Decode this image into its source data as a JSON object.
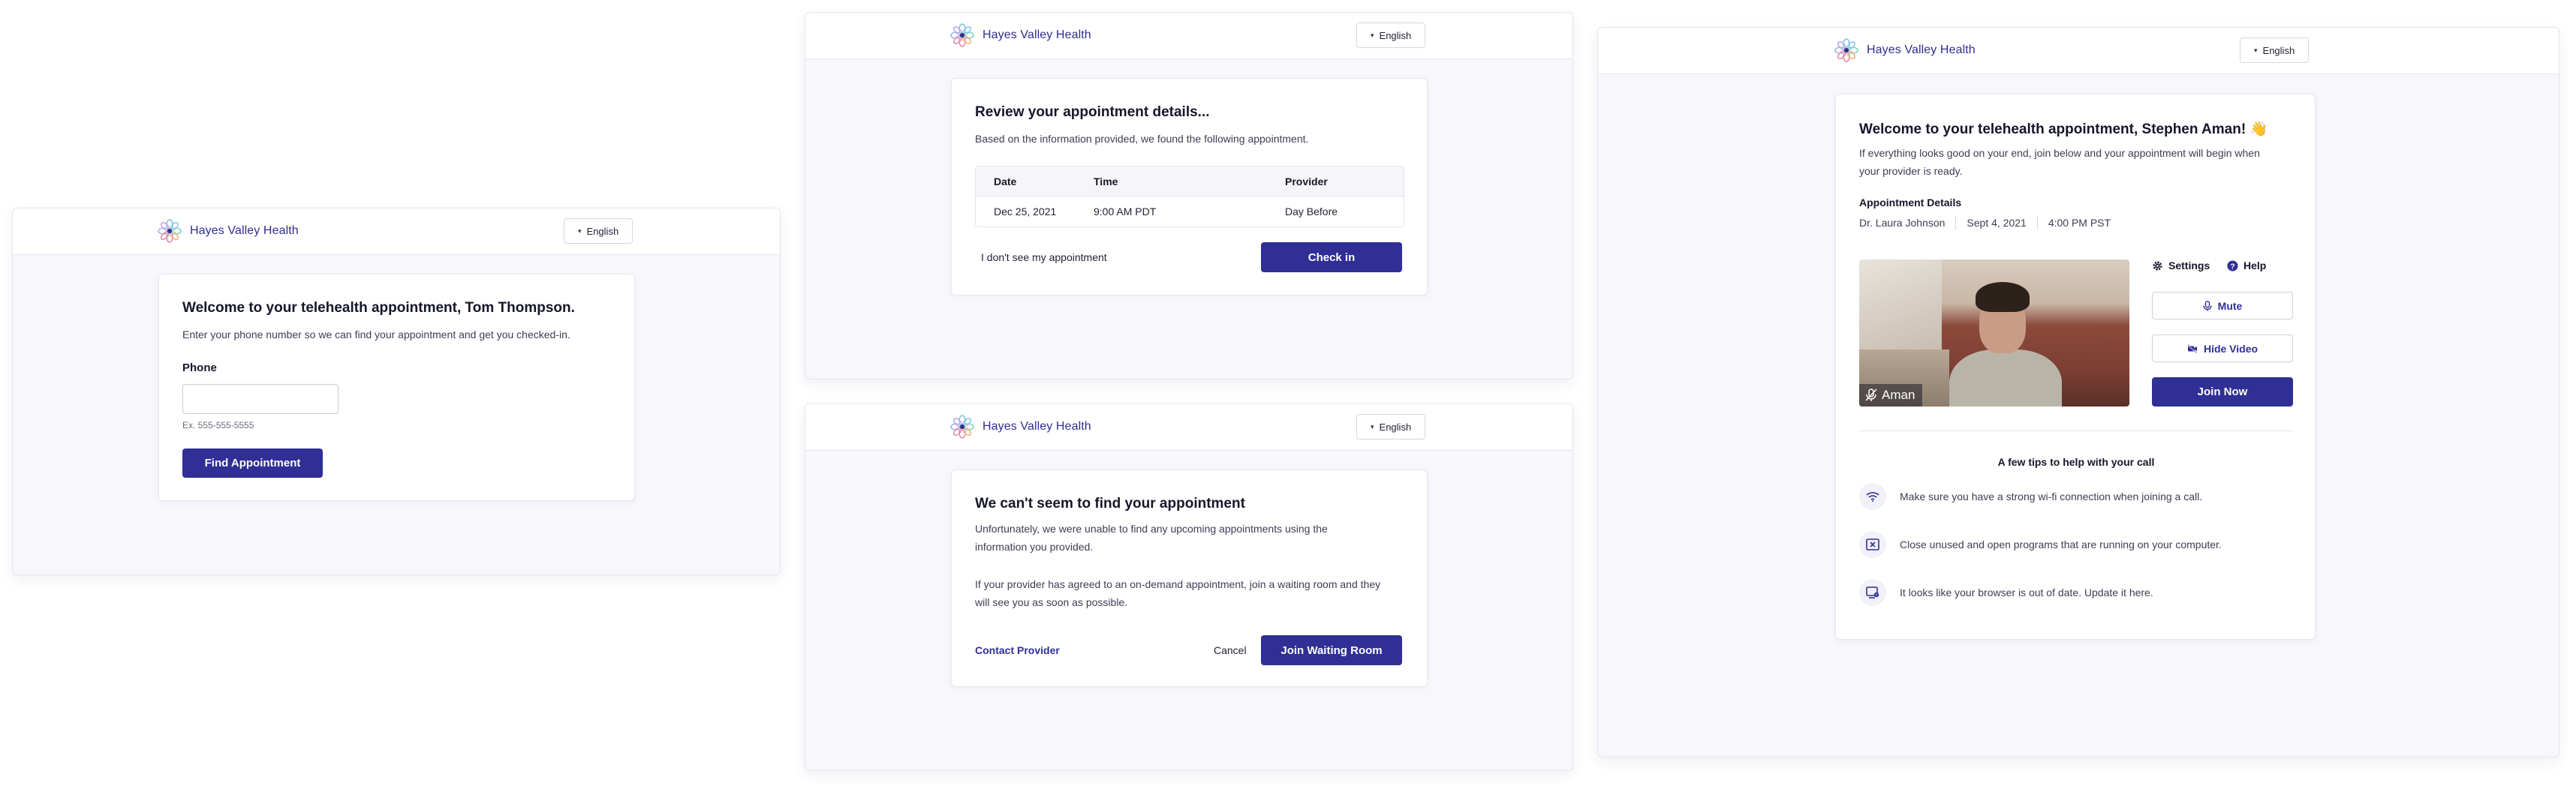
{
  "brand": {
    "name": "Hayes Valley Health"
  },
  "language": {
    "label": "English"
  },
  "find_screen": {
    "title": "Welcome to your telehealth appointment, Tom Thompson.",
    "subtitle": "Enter your phone number so we can find your appointment and get you checked-in.",
    "phone_label": "Phone",
    "phone_value": "",
    "phone_hint": "Ex. 555-555-5555",
    "submit_label": "Find Appointment"
  },
  "review_screen": {
    "title": "Review your appointment details...",
    "subtitle": "Based on the information provided, we found the following appointment.",
    "columns": [
      "Date",
      "Time",
      "Provider"
    ],
    "row": {
      "date": "Dec 25, 2021",
      "time": "9:00 AM PDT",
      "provider": "Day Before"
    },
    "not_mine_label": "I don't see my appointment",
    "checkin_label": "Check in"
  },
  "notfound_screen": {
    "title": "We can't seem to find your appointment",
    "paragraph1": "Unfortunately, we were unable to find any upcoming appointments using the information you provided.",
    "paragraph2": "If your provider has agreed to an on-demand appointment, join a waiting room and they will see you as soon as possible.",
    "contact_label": "Contact Provider",
    "cancel_label": "Cancel",
    "join_label": "Join Waiting Room"
  },
  "telehealth_screen": {
    "title": "Welcome to your telehealth appointment, Stephen Aman! 👋",
    "subtitle": "If everything looks good on your end, join below and your appointment will begin when your provider is ready.",
    "details_heading": "Appointment Details",
    "provider": "Dr. Laura Johnson",
    "date": "Sept 4, 2021",
    "time": "4:00 PM PST",
    "video_name": "Aman",
    "settings_label": "Settings",
    "help_label": "Help",
    "mute_label": "Mute",
    "hide_video_label": "Hide Video",
    "join_label": "Join Now",
    "tips_heading": "A few tips to help with your call",
    "tips": [
      "Make sure you have a strong wi-fi connection when joining a call.",
      "Close unused and open programs that are running on your computer.",
      "It looks like your browser is out of date. Update it here."
    ]
  },
  "colors": {
    "primary": "#2f2f96",
    "background": "#f7f7fc"
  }
}
